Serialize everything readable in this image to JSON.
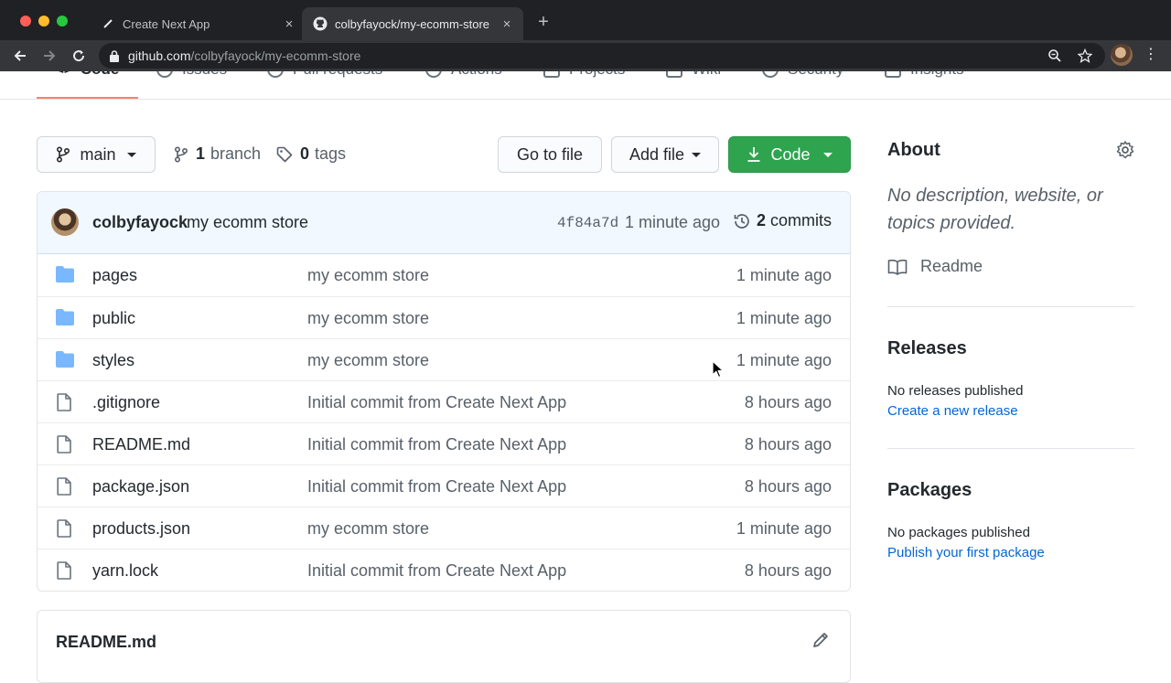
{
  "browser": {
    "tabs": [
      {
        "title": "Create Next App",
        "active": false
      },
      {
        "title": "colbyfayock/my-ecomm-store",
        "active": true
      }
    ],
    "url_host": "github.com",
    "url_path": "/colbyfayock/my-ecomm-store",
    "new_tab": "+",
    "close_glyph": "×"
  },
  "repo_nav": [
    {
      "label": "Code",
      "icon": "code-icon"
    },
    {
      "label": "Issues",
      "icon": "issue-icon"
    },
    {
      "label": "Pull requests",
      "icon": "pull-request-icon"
    },
    {
      "label": "Actions",
      "icon": "play-icon"
    },
    {
      "label": "Projects",
      "icon": "project-icon"
    },
    {
      "label": "Wiki",
      "icon": "book-icon"
    },
    {
      "label": "Security",
      "icon": "shield-icon"
    },
    {
      "label": "Insights",
      "icon": "graph-icon"
    }
  ],
  "file_nav": {
    "branch": "main",
    "branch_count": "1",
    "branch_label": "branch",
    "tag_count": "0",
    "tag_label": "tags",
    "go_to_file": "Go to file",
    "add_file": "Add file",
    "code": "Code"
  },
  "commit": {
    "author": "colbyfayock",
    "message": "my ecomm store",
    "sha": "4f84a7d",
    "time": "1 minute ago",
    "count": "2",
    "count_label": "commits"
  },
  "files": [
    {
      "name": "pages",
      "type": "dir",
      "message": "my ecomm store",
      "age": "1 minute ago"
    },
    {
      "name": "public",
      "type": "dir",
      "message": "my ecomm store",
      "age": "1 minute ago"
    },
    {
      "name": "styles",
      "type": "dir",
      "message": "my ecomm store",
      "age": "1 minute ago"
    },
    {
      "name": ".gitignore",
      "type": "file",
      "message": "Initial commit from Create Next App",
      "age": "8 hours ago"
    },
    {
      "name": "README.md",
      "type": "file",
      "message": "Initial commit from Create Next App",
      "age": "8 hours ago"
    },
    {
      "name": "package.json",
      "type": "file",
      "message": "Initial commit from Create Next App",
      "age": "8 hours ago"
    },
    {
      "name": "products.json",
      "type": "file",
      "message": "my ecomm store",
      "age": "1 minute ago"
    },
    {
      "name": "yarn.lock",
      "type": "file",
      "message": "Initial commit from Create Next App",
      "age": "8 hours ago"
    }
  ],
  "readme": {
    "title": "README.md"
  },
  "sidebar": {
    "about_title": "About",
    "about_desc": "No description, website, or topics provided.",
    "readme_label": "Readme",
    "releases_title": "Releases",
    "releases_text": "No releases published",
    "releases_link": "Create a new release",
    "packages_title": "Packages",
    "packages_text": "No packages published",
    "packages_link": "Publish your first package"
  },
  "colors": {
    "accent_green": "#2ea44f",
    "link_blue": "#0366d6",
    "nav_underline": "#f9826c",
    "folder_blue": "#79b8ff",
    "commit_bar_bg": "#f1f8ff"
  }
}
